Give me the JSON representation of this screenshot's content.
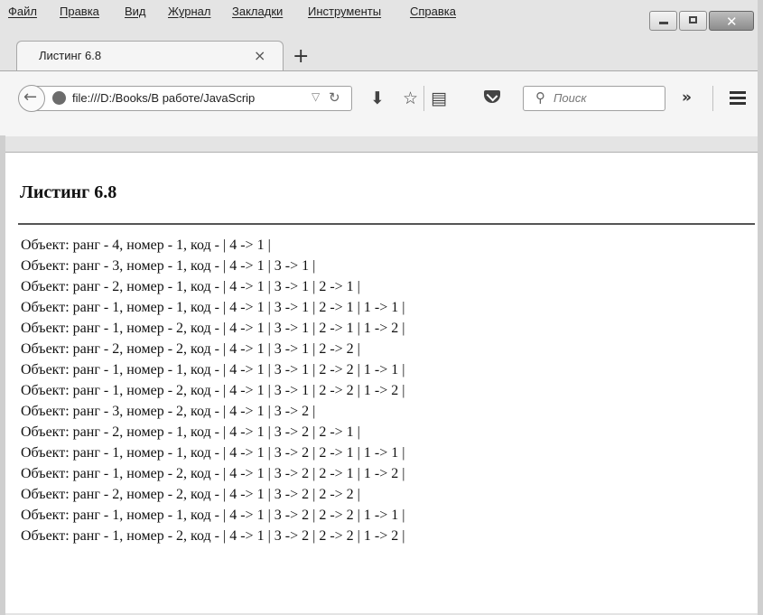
{
  "menubar": {
    "items": [
      "Файл",
      "Правка",
      "Вид",
      "Журнал",
      "Закладки",
      "Инструменты",
      "Справка"
    ]
  },
  "tab": {
    "title": "Листинг 6.8",
    "close_glyph": "×",
    "new_tab_glyph": "+"
  },
  "toolbar": {
    "url": "file:///D:/Books/В работе/JavaScrip",
    "search_placeholder": "Поиск",
    "overflow_glyph": "»"
  },
  "page": {
    "heading": "Листинг 6.8",
    "lines": [
      "Объект: ранг - 4, номер - 1, код - | 4 -> 1 |",
      "Объект: ранг - 3, номер - 1, код - | 4 -> 1 | 3 -> 1 |",
      "Объект: ранг - 2, номер - 1, код - | 4 -> 1 | 3 -> 1 | 2 -> 1 |",
      "Объект: ранг - 1, номер - 1, код - | 4 -> 1 | 3 -> 1 | 2 -> 1 | 1 -> 1 |",
      "Объект: ранг - 1, номер - 2, код - | 4 -> 1 | 3 -> 1 | 2 -> 1 | 1 -> 2 |",
      "Объект: ранг - 2, номер - 2, код - | 4 -> 1 | 3 -> 1 | 2 -> 2 |",
      "Объект: ранг - 1, номер - 1, код - | 4 -> 1 | 3 -> 1 | 2 -> 2 | 1 -> 1 |",
      "Объект: ранг - 1, номер - 2, код - | 4 -> 1 | 3 -> 1 | 2 -> 2 | 1 -> 2 |",
      "Объект: ранг - 3, номер - 2, код - | 4 -> 1 | 3 -> 2 |",
      "Объект: ранг - 2, номер - 1, код - | 4 -> 1 | 3 -> 2 | 2 -> 1 |",
      "Объект: ранг - 1, номер - 1, код - | 4 -> 1 | 3 -> 2 | 2 -> 1 | 1 -> 1 |",
      "Объект: ранг - 1, номер - 2, код - | 4 -> 1 | 3 -> 2 | 2 -> 1 | 1 -> 2 |",
      "Объект: ранг - 2, номер - 2, код - | 4 -> 1 | 3 -> 2 | 2 -> 2 |",
      "Объект: ранг - 1, номер - 1, код - | 4 -> 1 | 3 -> 2 | 2 -> 2 | 1 -> 1 |",
      "Объект: ранг - 1, номер - 2, код - | 4 -> 1 | 3 -> 2 | 2 -> 2 | 1 -> 2 |"
    ]
  },
  "icons": {
    "back": "back-arrow-icon",
    "site_identity": "globe-icon",
    "reload": "reload-icon",
    "download": "download-icon",
    "bookmark": "star-icon",
    "reading_list": "reading-list-icon",
    "pocket": "pocket-icon",
    "search": "search-icon",
    "menu": "hamburger-icon"
  }
}
